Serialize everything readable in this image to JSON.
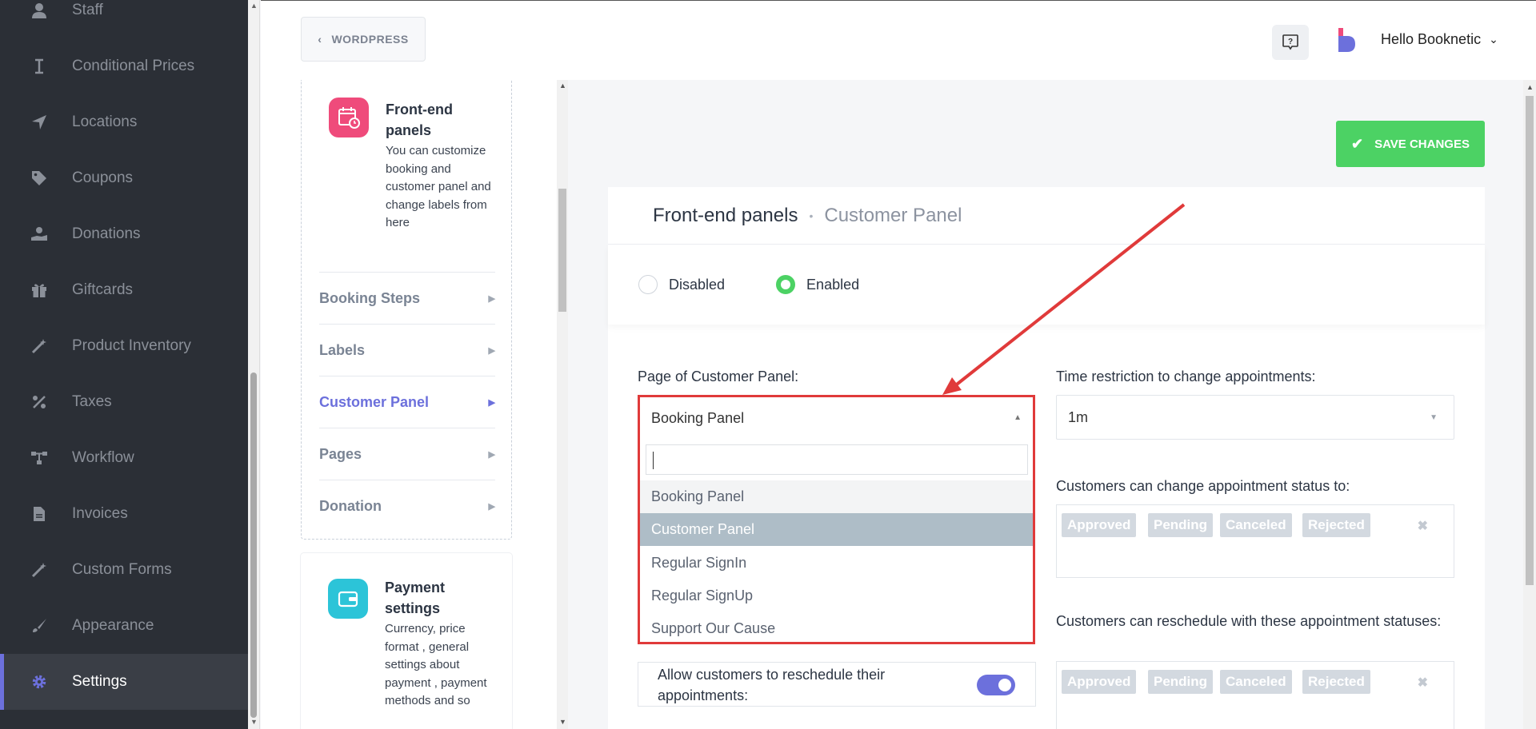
{
  "sidebar": {
    "items": [
      {
        "label": "Staff",
        "icon": "user-icon"
      },
      {
        "label": "Conditional Prices",
        "icon": "i-cursor-icon"
      },
      {
        "label": "Locations",
        "icon": "location-arrow-icon"
      },
      {
        "label": "Coupons",
        "icon": "tag-icon"
      },
      {
        "label": "Donations",
        "icon": "hand-holding-icon"
      },
      {
        "label": "Giftcards",
        "icon": "gift-icon"
      },
      {
        "label": "Product Inventory",
        "icon": "magic-wand-icon"
      },
      {
        "label": "Taxes",
        "icon": "percent-icon"
      },
      {
        "label": "Workflow",
        "icon": "workflow-icon"
      },
      {
        "label": "Invoices",
        "icon": "file-icon"
      },
      {
        "label": "Custom Forms",
        "icon": "magic-wand-icon"
      },
      {
        "label": "Appearance",
        "icon": "brush-icon"
      },
      {
        "label": "Settings",
        "icon": "gear-icon"
      }
    ],
    "active": "Settings"
  },
  "topbar": {
    "back_label": "WORDPRESS",
    "greeting": "Hello Booknetic"
  },
  "settings_nav": {
    "frontend": {
      "title": "Front-end panels",
      "description": "You can customize booking and customer panel and change labels from here",
      "submenu": [
        {
          "label": "Booking Steps"
        },
        {
          "label": "Labels"
        },
        {
          "label": "Customer Panel"
        },
        {
          "label": "Pages"
        },
        {
          "label": "Donation"
        }
      ]
    },
    "payment": {
      "title": "Payment settings",
      "description": "Currency, price format , general settings about payment , payment methods and so"
    }
  },
  "main": {
    "save_label": "SAVE CHANGES",
    "breadcrumb": {
      "section": "Front-end panels",
      "page": "Customer Panel"
    },
    "radio_disabled": "Disabled",
    "radio_enabled": "Enabled",
    "page_label": "Page of Customer Panel:",
    "page_value": "Booking Panel",
    "page_options": [
      "Booking Panel",
      "Customer Panel",
      "Regular SignIn",
      "Regular SignUp",
      "Support Our Cause"
    ],
    "time_label": "Time restriction to change appointments:",
    "time_value": "1m",
    "status_label": "Customers can change appointment status to:",
    "status_tags": [
      "Approved",
      "Pending",
      "Canceled",
      "Rejected"
    ],
    "reschedule_label": "Customers can reschedule with these appointment statuses:",
    "reschedule_tags": [
      "Approved",
      "Pending",
      "Canceled",
      "Rejected"
    ],
    "allow_reschedule_label": "Allow customers to reschedule their appointments:"
  },
  "colors": {
    "accent": "#6c70dc",
    "success": "#4cd264",
    "highlight_box": "#e03a3a",
    "sidebar_bg": "#2b2f36"
  }
}
